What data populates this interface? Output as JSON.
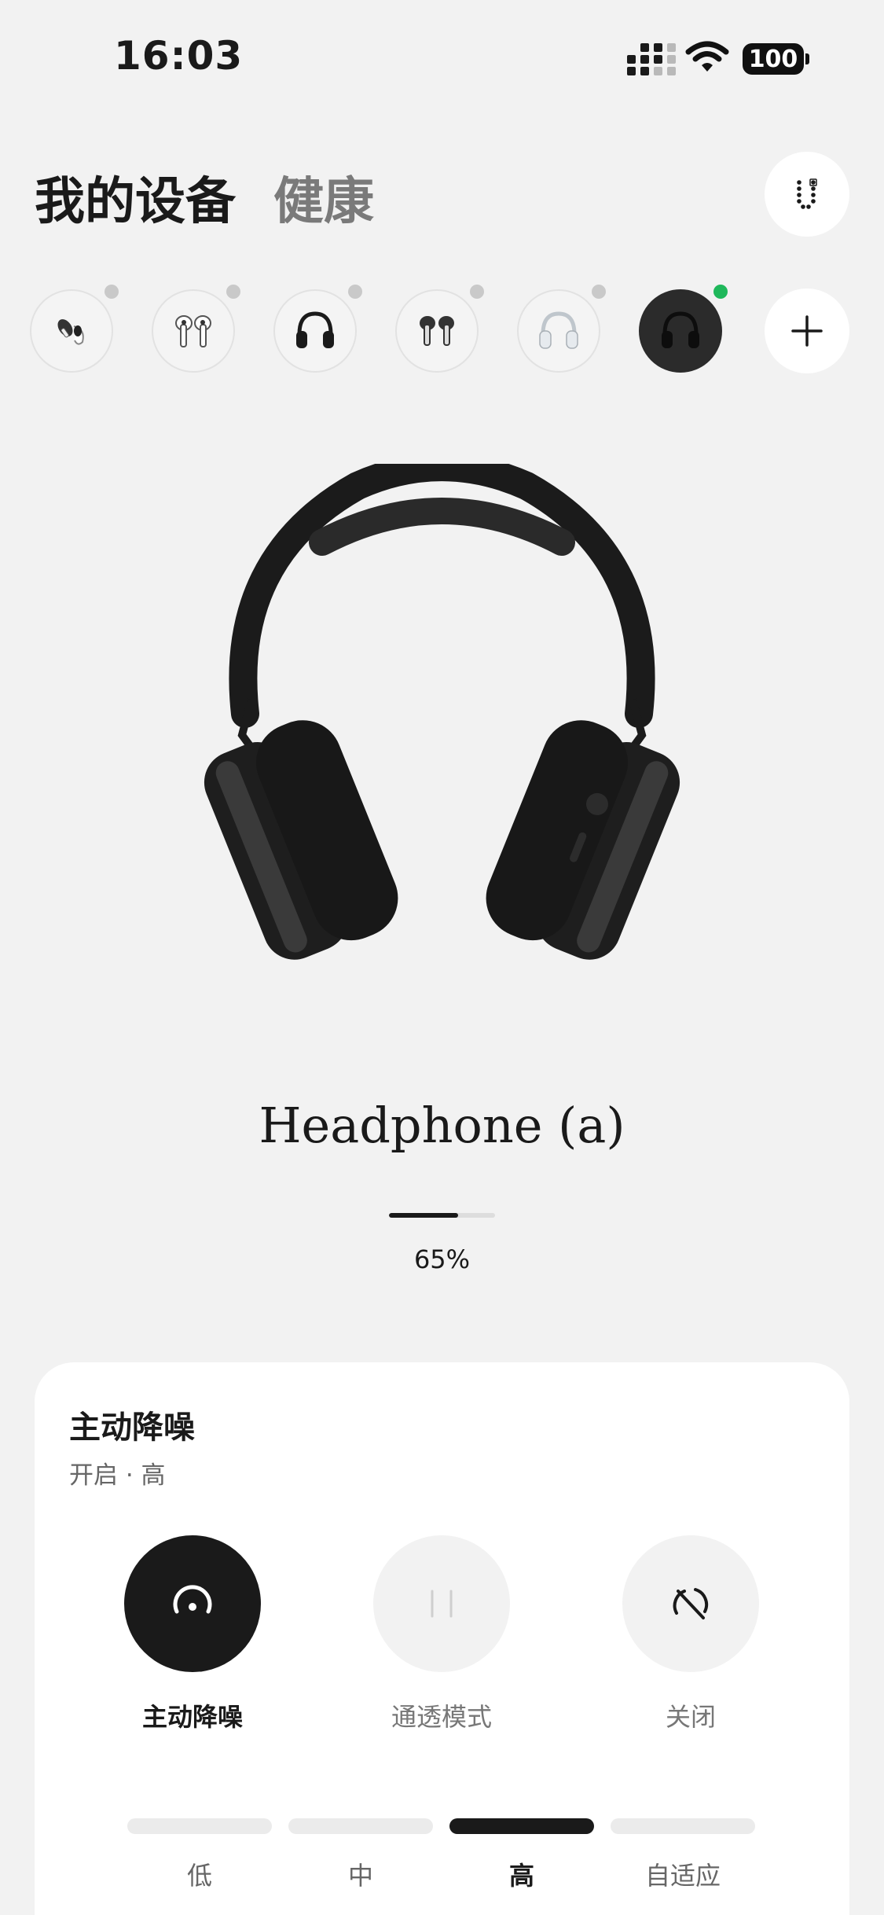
{
  "status_bar": {
    "time": "16:03",
    "battery": "100"
  },
  "header": {
    "tabs": [
      {
        "label": "我的设备",
        "active": true
      },
      {
        "label": "健康",
        "active": false
      }
    ],
    "profile_icon": "user-badge-icon"
  },
  "devices": [
    {
      "icon": "ear-earbuds-icon",
      "status": "disconnected"
    },
    {
      "icon": "earbuds-white-icon",
      "status": "disconnected"
    },
    {
      "icon": "headphone-black-icon",
      "status": "disconnected"
    },
    {
      "icon": "earbuds-dark-icon",
      "status": "disconnected"
    },
    {
      "icon": "headphone-white-icon",
      "status": "disconnected"
    },
    {
      "icon": "headphone-a-icon",
      "status": "connected",
      "selected": true
    }
  ],
  "add_device_icon": "plus-icon",
  "device": {
    "name": "Headphone (a)",
    "battery_percent": 65,
    "battery_text": "65%"
  },
  "anc": {
    "title": "主动降噪",
    "subtitle": "开启 · 高",
    "modes": [
      {
        "label": "主动降噪",
        "icon": "anc-icon",
        "active": true
      },
      {
        "label": "通透模式",
        "icon": "transparency-icon",
        "active": false
      },
      {
        "label": "关闭",
        "icon": "anc-off-icon",
        "active": false
      }
    ],
    "levels": [
      {
        "label": "低",
        "active": false
      },
      {
        "label": "中",
        "active": false
      },
      {
        "label": "高",
        "active": true
      },
      {
        "label": "自适应",
        "active": false
      }
    ]
  },
  "colors": {
    "background": "#f2f2f2",
    "card": "#ffffff",
    "accent": "#1a1a1a",
    "connected_dot": "#1fb85b"
  }
}
